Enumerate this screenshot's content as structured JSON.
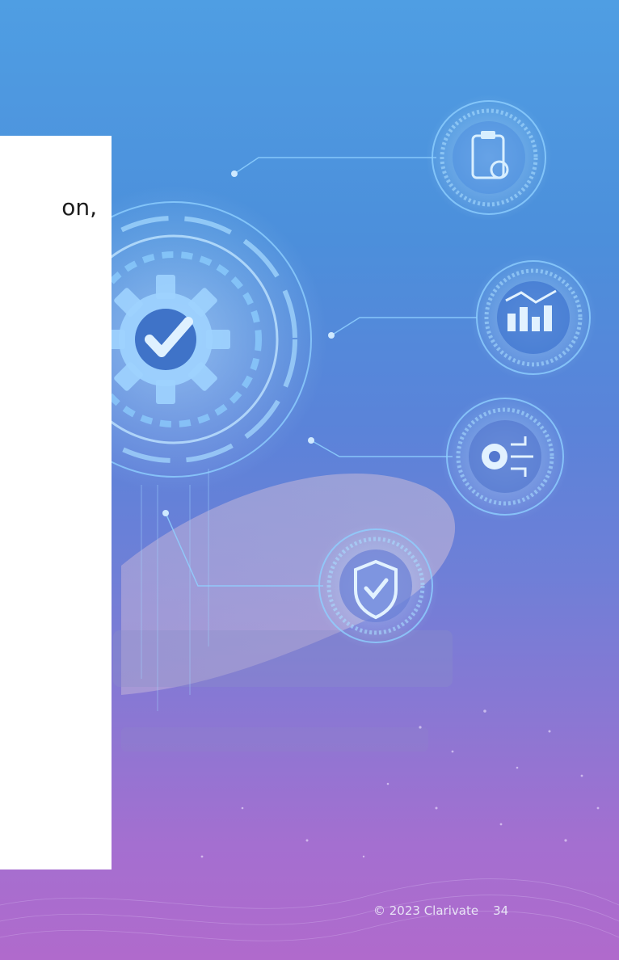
{
  "slide": {
    "text_fragment": "on,",
    "footer": {
      "copyright": "© 2023 Clarivate",
      "page_number": "34"
    }
  },
  "icons": [
    "gear-check-icon",
    "clipboard-gear-icon",
    "bar-chart-icon",
    "gear-circuit-icon",
    "shield-check-icon"
  ],
  "colors": {
    "glow": "#bfe3ff",
    "ring": "#8fd0ff",
    "card": "#ffffff"
  }
}
